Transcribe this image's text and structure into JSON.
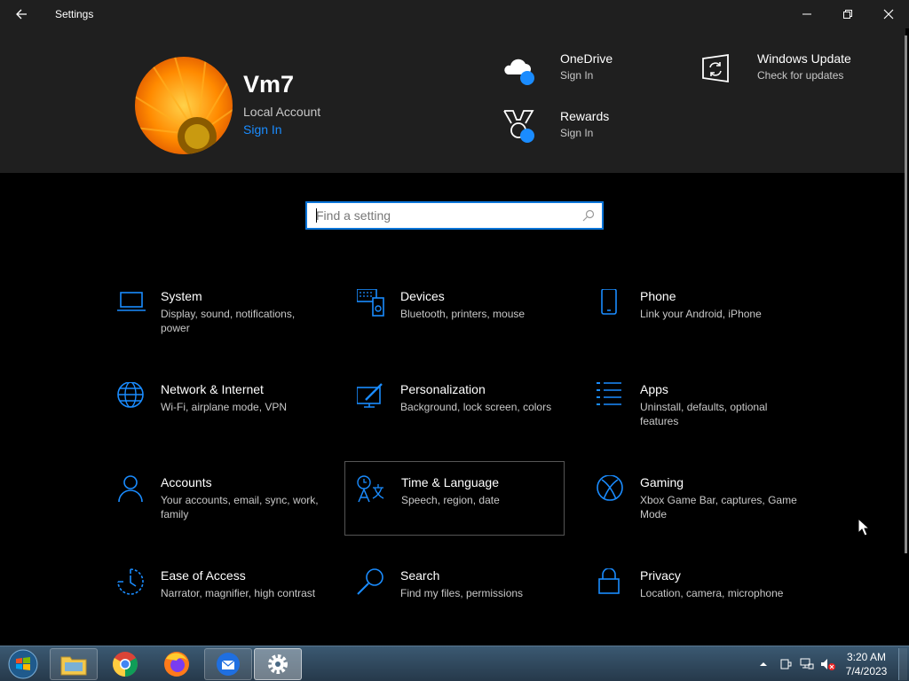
{
  "window": {
    "title": "Settings"
  },
  "account": {
    "name": "Vm7",
    "type": "Local Account",
    "sign_in": "Sign In"
  },
  "header_items": [
    {
      "title": "OneDrive",
      "sub": "Sign In"
    },
    {
      "title": "Windows Update",
      "sub": "Check for updates"
    },
    {
      "title": "Rewards",
      "sub": "Sign In"
    }
  ],
  "search": {
    "placeholder": "Find a setting"
  },
  "categories": [
    {
      "title": "System",
      "sub": "Display, sound, notifications, power",
      "icon": "laptop-icon"
    },
    {
      "title": "Devices",
      "sub": "Bluetooth, printers, mouse",
      "icon": "devices-icon"
    },
    {
      "title": "Phone",
      "sub": "Link your Android, iPhone",
      "icon": "phone-icon"
    },
    {
      "title": "Network & Internet",
      "sub": "Wi-Fi, airplane mode, VPN",
      "icon": "globe-icon"
    },
    {
      "title": "Personalization",
      "sub": "Background, lock screen, colors",
      "icon": "paint-icon"
    },
    {
      "title": "Apps",
      "sub": "Uninstall, defaults, optional features",
      "icon": "apps-list-icon"
    },
    {
      "title": "Accounts",
      "sub": "Your accounts, email, sync, work, family",
      "icon": "person-icon"
    },
    {
      "title": "Time & Language",
      "sub": "Speech, region, date",
      "icon": "time-language-icon"
    },
    {
      "title": "Gaming",
      "sub": "Xbox Game Bar, captures, Game Mode",
      "icon": "xbox-icon"
    },
    {
      "title": "Ease of Access",
      "sub": "Narrator, magnifier, high contrast",
      "icon": "ease-of-access-icon"
    },
    {
      "title": "Search",
      "sub": "Find my files, permissions",
      "icon": "search-icon"
    },
    {
      "title": "Privacy",
      "sub": "Location, camera, microphone",
      "icon": "lock-icon"
    }
  ],
  "taskbar": {
    "time": "3:20 AM",
    "date": "7/4/2023"
  },
  "colors": {
    "accent": "#1a8cff",
    "header_bg": "#1f1f1f",
    "page_bg": "#000000"
  }
}
